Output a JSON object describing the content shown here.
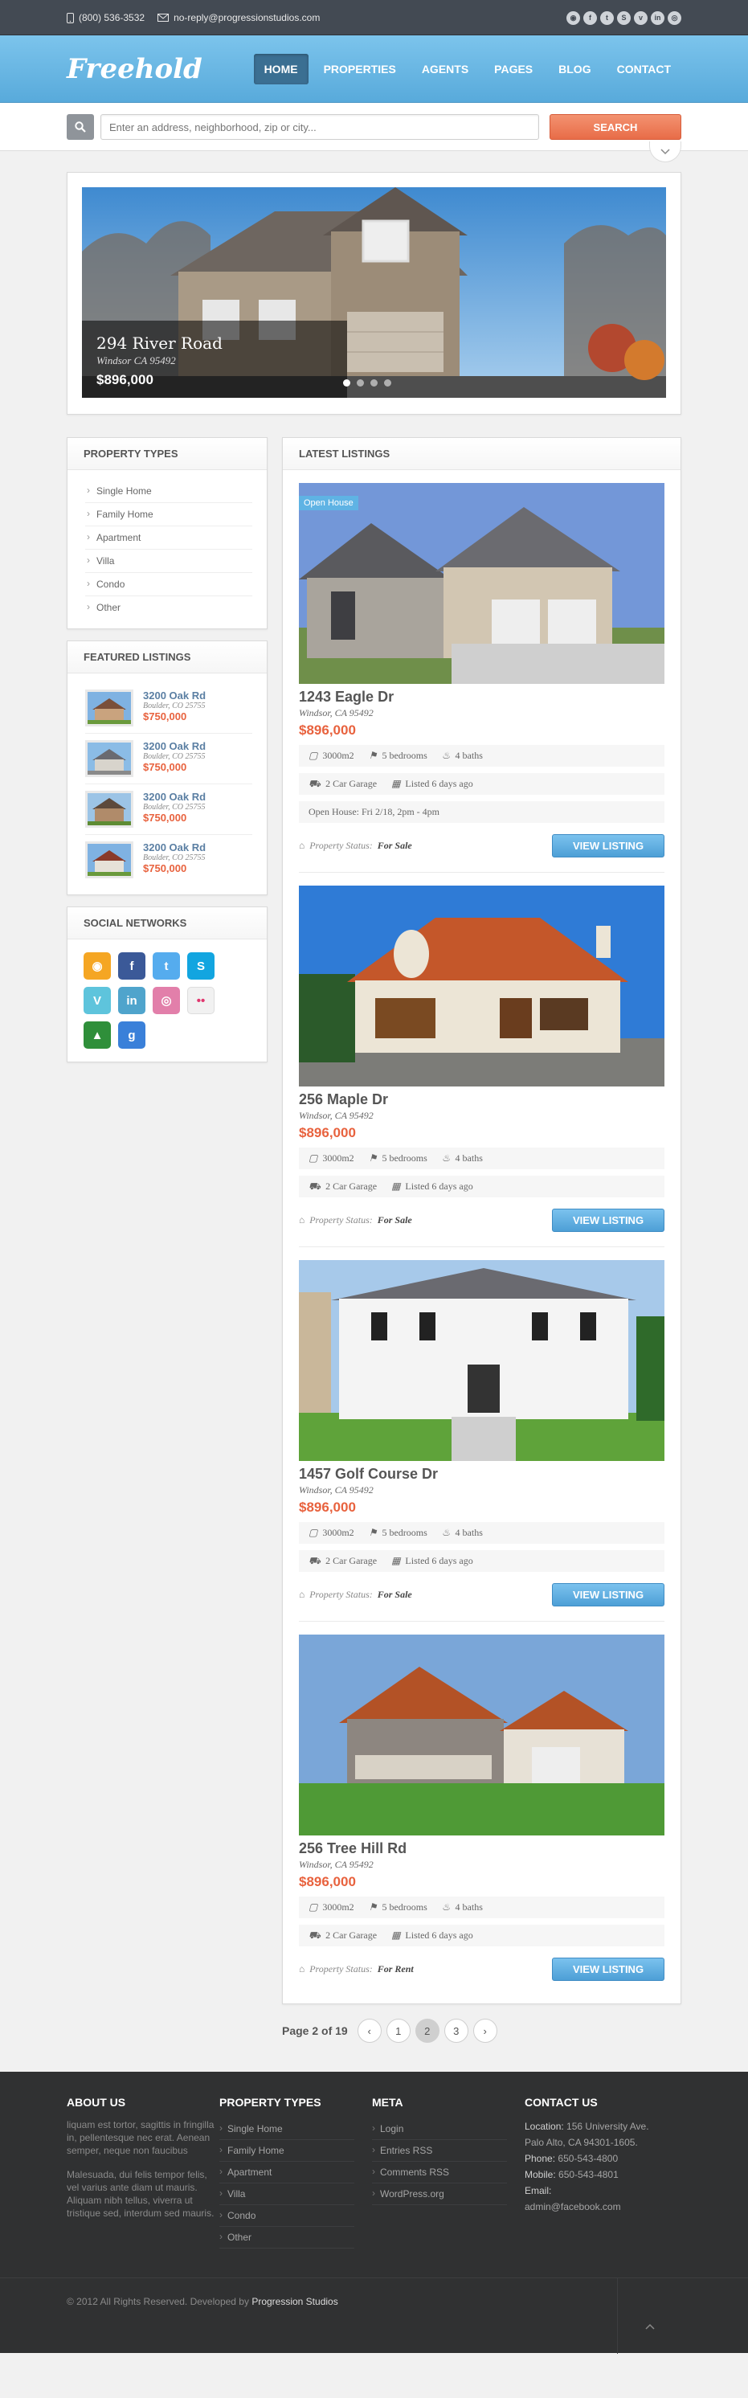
{
  "topbar": {
    "phone": "(800) 536-3532",
    "email": "no-reply@progressionstudios.com",
    "socials": [
      "rss-icon",
      "facebook-icon",
      "twitter-icon",
      "skype-icon",
      "vimeo-icon",
      "linkedin-icon",
      "dribbble-icon"
    ]
  },
  "header": {
    "logo": "Freehold",
    "nav": [
      "HOME",
      "PROPERTIES",
      "AGENTS",
      "PAGES",
      "BLOG",
      "CONTACT"
    ],
    "active": 0
  },
  "search": {
    "placeholder": "Enter an address, neighborhood, zip or city...",
    "button": "SEARCH"
  },
  "slider": {
    "title": "294 River Road",
    "city": "Windsor CA 95492",
    "price": "$896,000",
    "dots": 4,
    "active_dot": 0
  },
  "sidebar": {
    "property_types_title": "PROPERTY TYPES",
    "property_types": [
      "Single Home",
      "Family Home",
      "Apartment",
      "Villa",
      "Condo",
      "Other"
    ],
    "featured_title": "FEATURED LISTINGS",
    "featured": [
      {
        "address": "3200 Oak Rd",
        "city": "Boulder, CO 25755",
        "price": "$750,000"
      },
      {
        "address": "3200 Oak Rd",
        "city": "Boulder, CO 25755",
        "price": "$750,000"
      },
      {
        "address": "3200 Oak Rd",
        "city": "Boulder, CO 25755",
        "price": "$750,000"
      },
      {
        "address": "3200 Oak Rd",
        "city": "Boulder, CO 25755",
        "price": "$750,000"
      }
    ],
    "social_title": "SOCIAL NETWORKS",
    "social": [
      {
        "icon": "rss-icon",
        "glyph": "◉",
        "color": "#f5a623"
      },
      {
        "icon": "facebook-icon",
        "glyph": "f",
        "color": "#3b5998"
      },
      {
        "icon": "twitter-icon",
        "glyph": "t",
        "color": "#55acee"
      },
      {
        "icon": "skype-icon",
        "glyph": "S",
        "color": "#12a5e0"
      },
      {
        "icon": "vimeo-icon",
        "glyph": "V",
        "color": "#5ec4dc"
      },
      {
        "icon": "linkedin-icon",
        "glyph": "in",
        "color": "#4fa4cc"
      },
      {
        "icon": "dribbble-icon",
        "glyph": "◎",
        "color": "#e27faa"
      },
      {
        "icon": "flickr-icon",
        "glyph": "••",
        "color": "#f1f1f1"
      },
      {
        "icon": "tree-icon",
        "glyph": "▲",
        "color": "#2f8f3a"
      },
      {
        "icon": "google-icon",
        "glyph": "g",
        "color": "#3a80d9"
      }
    ]
  },
  "listings_title": "LATEST LISTINGS",
  "listings": [
    {
      "badge": "Open House",
      "title": "1243 Eagle Dr",
      "city": "Windsor, CA 95492",
      "price": "$896,000",
      "size": "3000m2",
      "beds": "5 bedrooms",
      "baths": "4 baths",
      "garage": "2 Car Garage",
      "listed": "Listed 6 days ago",
      "open_house": "Open House: Fri 2/18, 2pm - 4pm",
      "status_label": "Property Status:",
      "status": "For Sale",
      "button": "VIEW LISTING"
    },
    {
      "badge": "",
      "title": "256 Maple Dr",
      "city": "Windsor, CA 95492",
      "price": "$896,000",
      "size": "3000m2",
      "beds": "5 bedrooms",
      "baths": "4 baths",
      "garage": "2 Car Garage",
      "listed": "Listed 6 days ago",
      "open_house": "",
      "status_label": "Property Status:",
      "status": "For Sale",
      "button": "VIEW LISTING"
    },
    {
      "badge": "",
      "title": "1457 Golf Course Dr",
      "city": "Windsor, CA 95492",
      "price": "$896,000",
      "size": "3000m2",
      "beds": "5 bedrooms",
      "baths": "4 baths",
      "garage": "2 Car Garage",
      "listed": "Listed 6 days ago",
      "open_house": "",
      "status_label": "Property Status:",
      "status": "For Sale",
      "button": "VIEW LISTING"
    },
    {
      "badge": "",
      "title": "256 Tree Hill Rd",
      "city": "Windsor, CA 95492",
      "price": "$896,000",
      "size": "3000m2",
      "beds": "5 bedrooms",
      "baths": "4 baths",
      "garage": "2 Car Garage",
      "listed": "Listed 6 days ago",
      "open_house": "",
      "status_label": "Property Status:",
      "status": "For Rent",
      "button": "VIEW LISTING"
    }
  ],
  "pager": {
    "label": "Page 2 of 19",
    "prev": "‹",
    "pages": [
      "1",
      "2",
      "3"
    ],
    "current": "2",
    "next": "›"
  },
  "footer": {
    "about_title": "ABOUT US",
    "about_p1": "liquam est tortor, sagittis in fringilla in, pellentesque nec erat. Aenean semper, neque non faucibus",
    "about_p2": "Malesuada, dui felis tempor felis, vel varius ante diam ut mauris. Aliquam nibh tellus, viverra ut tristique sed, interdum sed mauris.",
    "types_title": "PROPERTY TYPES",
    "types": [
      "Single Home",
      "Family Home",
      "Apartment",
      "Villa",
      "Condo",
      "Other"
    ],
    "meta_title": "META",
    "meta": [
      "Login",
      "Entries RSS",
      "Comments RSS",
      "WordPress.org"
    ],
    "contact_title": "CONTACT US",
    "location_label": "Location:",
    "location": "156 University Ave.",
    "location2": "Palo Alto, CA 94301-1605.",
    "phone_label": "Phone:",
    "phone": "650-543-4800",
    "mobile_label": "Mobile:",
    "mobile": "650-543-4801",
    "email_label": "Email:",
    "email": "admin@facebook.com",
    "copyright": "© 2012 All Rights Reserved. Developed by",
    "developer": "Progression Studios"
  }
}
